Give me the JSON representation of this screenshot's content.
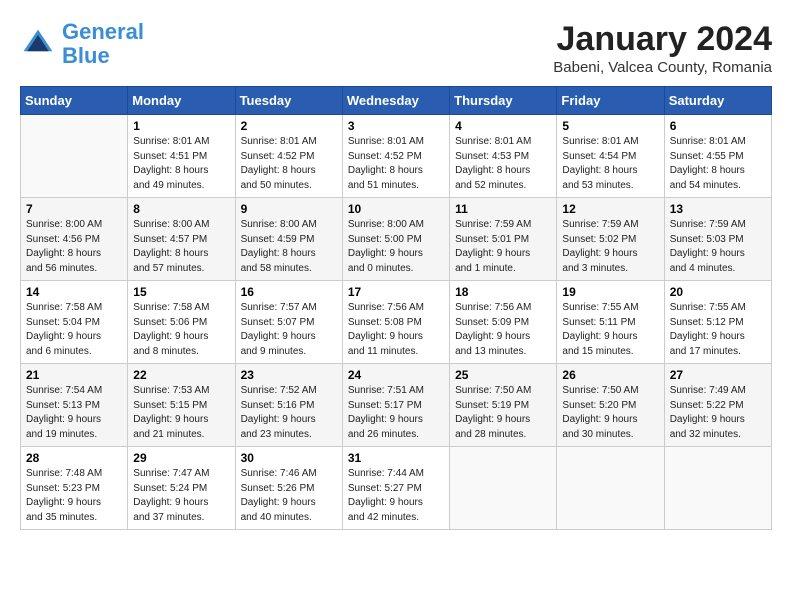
{
  "header": {
    "logo_line1": "General",
    "logo_line2": "Blue",
    "month_title": "January 2024",
    "location": "Babeni, Valcea County, Romania"
  },
  "weekdays": [
    "Sunday",
    "Monday",
    "Tuesday",
    "Wednesday",
    "Thursday",
    "Friday",
    "Saturday"
  ],
  "weeks": [
    [
      {
        "day": "",
        "info": ""
      },
      {
        "day": "1",
        "info": "Sunrise: 8:01 AM\nSunset: 4:51 PM\nDaylight: 8 hours\nand 49 minutes."
      },
      {
        "day": "2",
        "info": "Sunrise: 8:01 AM\nSunset: 4:52 PM\nDaylight: 8 hours\nand 50 minutes."
      },
      {
        "day": "3",
        "info": "Sunrise: 8:01 AM\nSunset: 4:52 PM\nDaylight: 8 hours\nand 51 minutes."
      },
      {
        "day": "4",
        "info": "Sunrise: 8:01 AM\nSunset: 4:53 PM\nDaylight: 8 hours\nand 52 minutes."
      },
      {
        "day": "5",
        "info": "Sunrise: 8:01 AM\nSunset: 4:54 PM\nDaylight: 8 hours\nand 53 minutes."
      },
      {
        "day": "6",
        "info": "Sunrise: 8:01 AM\nSunset: 4:55 PM\nDaylight: 8 hours\nand 54 minutes."
      }
    ],
    [
      {
        "day": "7",
        "info": "Sunrise: 8:00 AM\nSunset: 4:56 PM\nDaylight: 8 hours\nand 56 minutes."
      },
      {
        "day": "8",
        "info": "Sunrise: 8:00 AM\nSunset: 4:57 PM\nDaylight: 8 hours\nand 57 minutes."
      },
      {
        "day": "9",
        "info": "Sunrise: 8:00 AM\nSunset: 4:59 PM\nDaylight: 8 hours\nand 58 minutes."
      },
      {
        "day": "10",
        "info": "Sunrise: 8:00 AM\nSunset: 5:00 PM\nDaylight: 9 hours\nand 0 minutes."
      },
      {
        "day": "11",
        "info": "Sunrise: 7:59 AM\nSunset: 5:01 PM\nDaylight: 9 hours\nand 1 minute."
      },
      {
        "day": "12",
        "info": "Sunrise: 7:59 AM\nSunset: 5:02 PM\nDaylight: 9 hours\nand 3 minutes."
      },
      {
        "day": "13",
        "info": "Sunrise: 7:59 AM\nSunset: 5:03 PM\nDaylight: 9 hours\nand 4 minutes."
      }
    ],
    [
      {
        "day": "14",
        "info": "Sunrise: 7:58 AM\nSunset: 5:04 PM\nDaylight: 9 hours\nand 6 minutes."
      },
      {
        "day": "15",
        "info": "Sunrise: 7:58 AM\nSunset: 5:06 PM\nDaylight: 9 hours\nand 8 minutes."
      },
      {
        "day": "16",
        "info": "Sunrise: 7:57 AM\nSunset: 5:07 PM\nDaylight: 9 hours\nand 9 minutes."
      },
      {
        "day": "17",
        "info": "Sunrise: 7:56 AM\nSunset: 5:08 PM\nDaylight: 9 hours\nand 11 minutes."
      },
      {
        "day": "18",
        "info": "Sunrise: 7:56 AM\nSunset: 5:09 PM\nDaylight: 9 hours\nand 13 minutes."
      },
      {
        "day": "19",
        "info": "Sunrise: 7:55 AM\nSunset: 5:11 PM\nDaylight: 9 hours\nand 15 minutes."
      },
      {
        "day": "20",
        "info": "Sunrise: 7:55 AM\nSunset: 5:12 PM\nDaylight: 9 hours\nand 17 minutes."
      }
    ],
    [
      {
        "day": "21",
        "info": "Sunrise: 7:54 AM\nSunset: 5:13 PM\nDaylight: 9 hours\nand 19 minutes."
      },
      {
        "day": "22",
        "info": "Sunrise: 7:53 AM\nSunset: 5:15 PM\nDaylight: 9 hours\nand 21 minutes."
      },
      {
        "day": "23",
        "info": "Sunrise: 7:52 AM\nSunset: 5:16 PM\nDaylight: 9 hours\nand 23 minutes."
      },
      {
        "day": "24",
        "info": "Sunrise: 7:51 AM\nSunset: 5:17 PM\nDaylight: 9 hours\nand 26 minutes."
      },
      {
        "day": "25",
        "info": "Sunrise: 7:50 AM\nSunset: 5:19 PM\nDaylight: 9 hours\nand 28 minutes."
      },
      {
        "day": "26",
        "info": "Sunrise: 7:50 AM\nSunset: 5:20 PM\nDaylight: 9 hours\nand 30 minutes."
      },
      {
        "day": "27",
        "info": "Sunrise: 7:49 AM\nSunset: 5:22 PM\nDaylight: 9 hours\nand 32 minutes."
      }
    ],
    [
      {
        "day": "28",
        "info": "Sunrise: 7:48 AM\nSunset: 5:23 PM\nDaylight: 9 hours\nand 35 minutes."
      },
      {
        "day": "29",
        "info": "Sunrise: 7:47 AM\nSunset: 5:24 PM\nDaylight: 9 hours\nand 37 minutes."
      },
      {
        "day": "30",
        "info": "Sunrise: 7:46 AM\nSunset: 5:26 PM\nDaylight: 9 hours\nand 40 minutes."
      },
      {
        "day": "31",
        "info": "Sunrise: 7:44 AM\nSunset: 5:27 PM\nDaylight: 9 hours\nand 42 minutes."
      },
      {
        "day": "",
        "info": ""
      },
      {
        "day": "",
        "info": ""
      },
      {
        "day": "",
        "info": ""
      }
    ]
  ]
}
